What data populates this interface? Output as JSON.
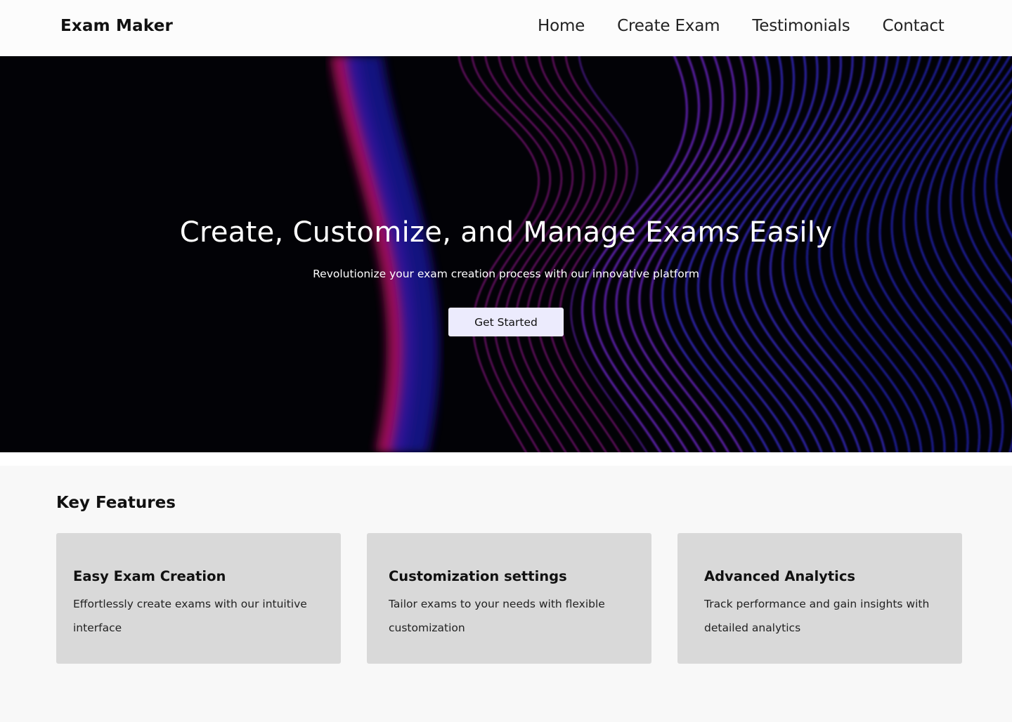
{
  "header": {
    "brand": "Exam Maker",
    "nav": [
      "Home",
      "Create Exam",
      "Testimonials",
      "Contact"
    ]
  },
  "hero": {
    "title": "Create, Customize, and Manage Exams Easily",
    "subtitle": "Revolutionize your exam creation process with our innovative platform",
    "cta_label": "Get Started",
    "background_color": "#020206",
    "wave_colors": [
      "#e0107a",
      "#2a1fcf",
      "#8a2be2",
      "#c21fb8"
    ]
  },
  "features": {
    "title": "Key Features",
    "cards": [
      {
        "title": "Easy Exam Creation",
        "description": "Effortlessly create exams with our intuitive interface"
      },
      {
        "title": "Customization settings",
        "description": "Tailor exams to your needs with flexible customization"
      },
      {
        "title": "Advanced Analytics",
        "description": "Track performance and gain insights with detailed analytics"
      }
    ]
  },
  "colors": {
    "header_bg": "#fcfcfc",
    "features_bg": "#f8f8f8",
    "card_bg": "#d9d9d9",
    "button_bg": "#ecebfd"
  }
}
